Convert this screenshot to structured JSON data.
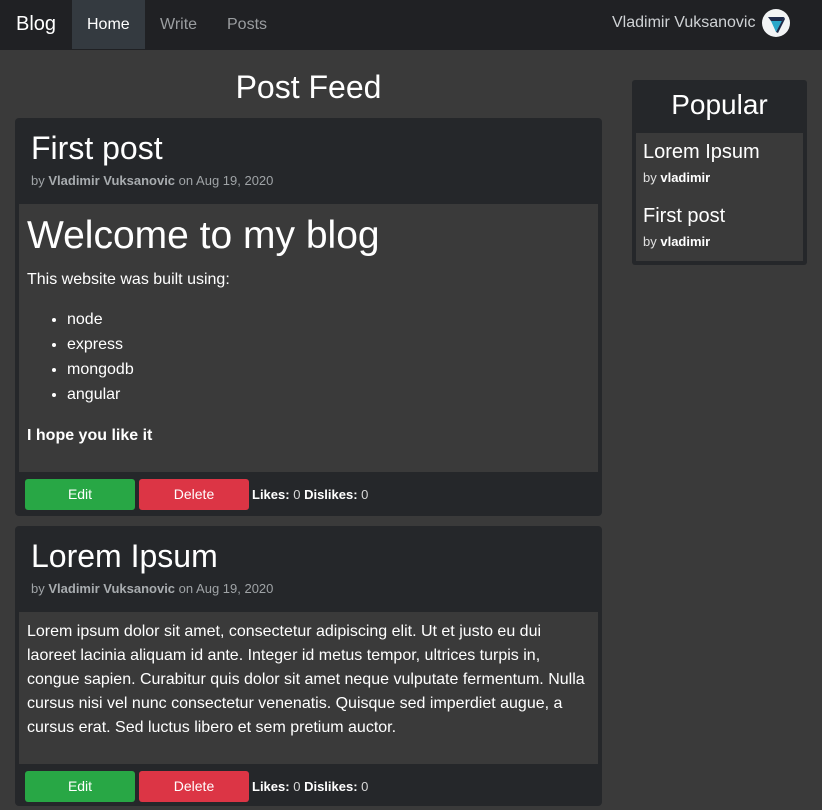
{
  "nav": {
    "brand": "Blog",
    "items": [
      {
        "label": "Home",
        "active": true
      },
      {
        "label": "Write",
        "active": false
      },
      {
        "label": "Posts",
        "active": false
      }
    ],
    "user_name": "Vladimir Vuksanovic"
  },
  "feed": {
    "title": "Post Feed",
    "by_prefix": "by",
    "on_word": "on",
    "likes_label": "Likes:",
    "dislikes_label": "Dislikes:",
    "edit_label": "Edit",
    "delete_label": "Delete",
    "posts": [
      {
        "title": "First post",
        "author": "Vladimir Vuksanovic",
        "date": "Aug 19, 2020",
        "heading": "Welcome to my blog",
        "intro": "This website was built using:",
        "list": [
          "node",
          "express",
          "mongodb",
          "angular"
        ],
        "closing": "I hope you like it",
        "likes": "0",
        "dislikes": "0"
      },
      {
        "title": "Lorem Ipsum",
        "author": "Vladimir Vuksanovic",
        "date": "Aug 19, 2020",
        "body": "Lorem ipsum dolor sit amet, consectetur adipiscing elit. Ut et justo eu dui laoreet lacinia aliquam id ante. Integer id metus tempor, ultrices turpis in, congue sapien. Curabitur quis dolor sit amet neque vulputate fermentum. Nulla cursus nisi vel nunc consectetur venenatis. Quisque sed imperdiet augue, a cursus erat. Sed luctus libero et sem pretium auctor.",
        "likes": "0",
        "dislikes": "0"
      }
    ]
  },
  "sidebar": {
    "title": "Popular",
    "by_prefix": "by",
    "items": [
      {
        "title": "Lorem Ipsum",
        "author": "vladimir"
      },
      {
        "title": "First post",
        "author": "vladimir"
      }
    ]
  },
  "colors": {
    "edit": "#28a745",
    "delete": "#dc3545",
    "navbar": "#202124",
    "card": "#25272a",
    "background": "#3a3a3a"
  },
  "icons": {
    "avatar": "logo-avatar-icon"
  }
}
